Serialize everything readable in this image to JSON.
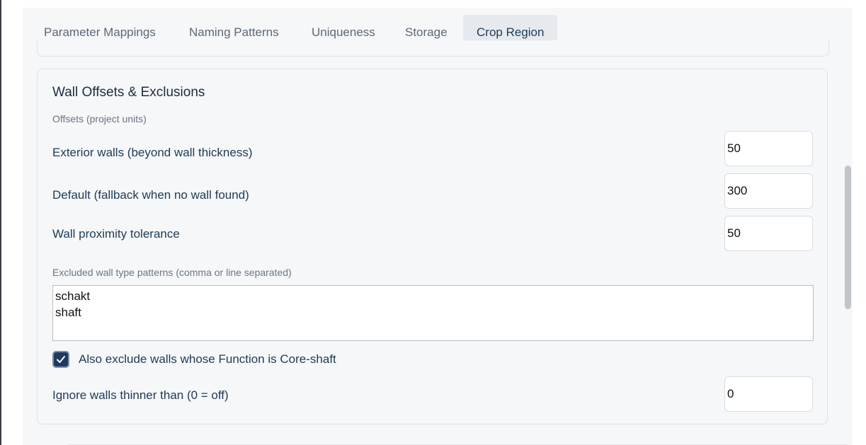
{
  "tabs": [
    {
      "label": "Parameter Mappings",
      "active": false
    },
    {
      "label": "Naming Patterns",
      "active": false
    },
    {
      "label": "Uniqueness",
      "active": false
    },
    {
      "label": "Storage",
      "active": false
    },
    {
      "label": "Crop Region",
      "active": true
    }
  ],
  "card": {
    "title": "Wall Offsets & Exclusions",
    "offsets_section_label": "Offsets (project units)",
    "exterior_walls": {
      "label": "Exterior walls (beyond wall thickness)",
      "value": "50"
    },
    "default_offset": {
      "label": "Default (fallback when no wall found)",
      "value": "300"
    },
    "proximity_tolerance": {
      "label": "Wall proximity tolerance",
      "value": "50"
    },
    "excluded_patterns": {
      "label": "Excluded wall type patterns (comma or line separated)",
      "value": "schakt\nshaft"
    },
    "exclude_core_shaft": {
      "label": "Also exclude walls whose Function is Core-shaft",
      "checked": true
    },
    "ignore_thin_walls": {
      "label": "Ignore walls thinner than (0 = off)",
      "value": "0"
    }
  },
  "colors": {
    "accent": "#1e3a5f",
    "label_text": "#1f3a56",
    "muted_text": "#6b7683",
    "panel_bg": "#f5f7f9"
  }
}
